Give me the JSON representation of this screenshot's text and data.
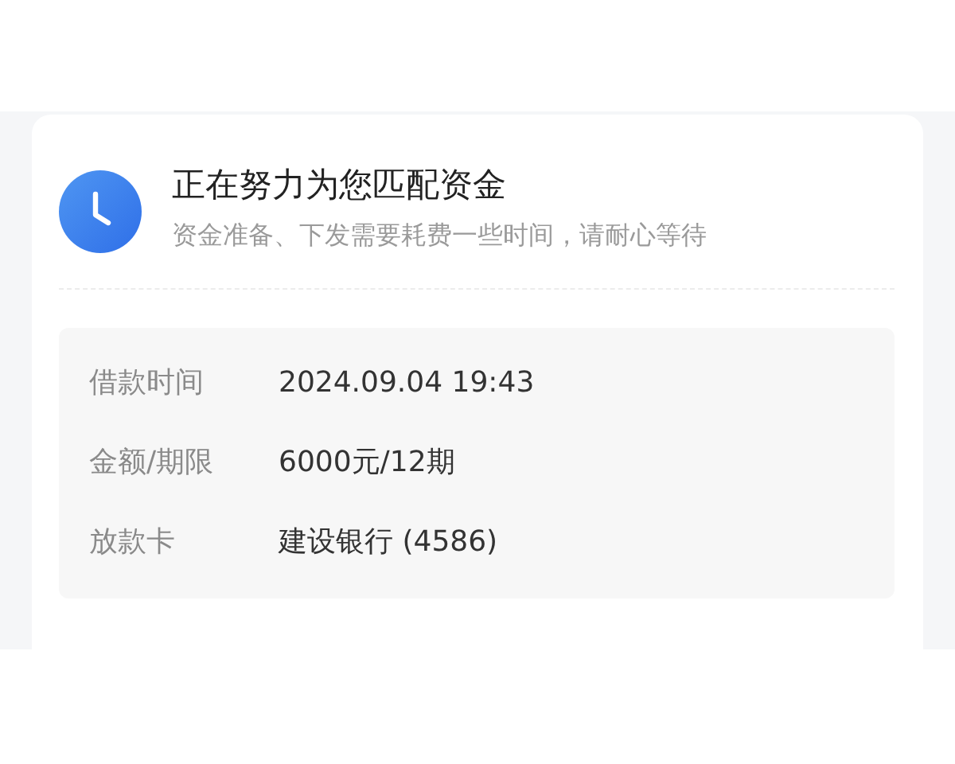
{
  "status": {
    "title": "正在努力为您匹配资金",
    "subtitle": "资金准备、下发需要耗费一些时间，请耐心等待"
  },
  "details": [
    {
      "label": "借款时间",
      "value": "2024.09.04 19:43"
    },
    {
      "label": "金额/期限",
      "value": "6000元/12期"
    },
    {
      "label": "放款卡",
      "value": "建设银行 (4586)"
    }
  ]
}
